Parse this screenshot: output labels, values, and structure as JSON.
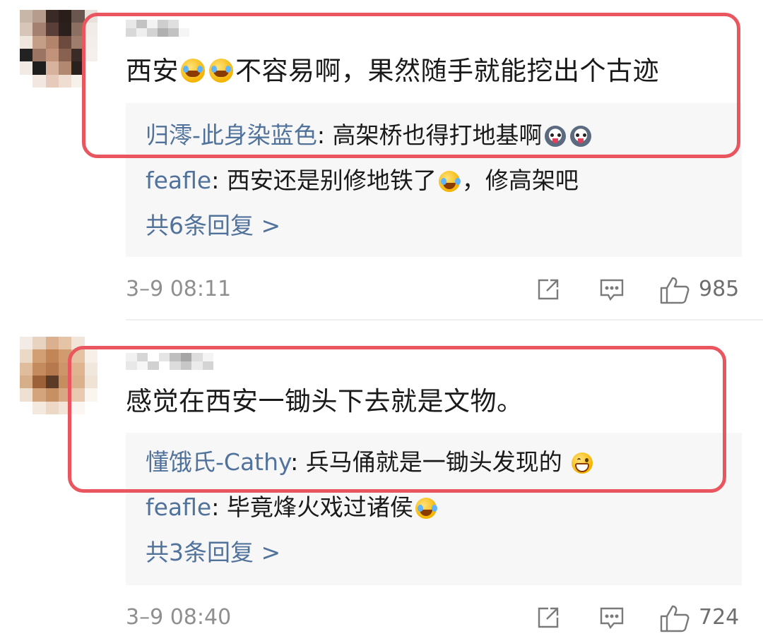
{
  "comments": [
    {
      "content_text_1": "西安",
      "content_text_2": "不容易啊，果然随手就能挖出个古迹",
      "content_emojis": [
        "laugh-cry-emoji",
        "laugh-cry-emoji"
      ],
      "replies": [
        {
          "name": "归澪-此身染蓝色",
          "sep": ": ",
          "text": "高架桥也得打地基啊",
          "emojis": [
            "husky-emoji",
            "husky-emoji"
          ]
        },
        {
          "name": "feafle",
          "sep": ": ",
          "text_1": "西安还是别修地铁了",
          "text_2": "，修高架吧",
          "emojis": [
            "laugh-cry-emoji"
          ]
        }
      ],
      "more_replies": "共6条回复 >",
      "time": "3–9 08:11",
      "likes": "985"
    },
    {
      "content_text_1": "感觉在西安一锄头下去就是文物。",
      "replies": [
        {
          "name": "懂饿氏-Cathy",
          "sep": ": ",
          "text": "兵马俑就是一锄头发现的 ",
          "emojis": [
            "grin-emoji"
          ]
        },
        {
          "name": "feafle",
          "sep": ": ",
          "text": "毕竟烽火戏过诸侯",
          "emojis": [
            "laugh-emoji"
          ]
        }
      ],
      "more_replies": "共3条回复 >",
      "time": "3–9 08:40",
      "likes": "724"
    }
  ],
  "icons": {
    "share": "share-icon",
    "comment": "comment-icon",
    "like": "thumbs-up-icon"
  },
  "colors": {
    "link_blue": "#51729b",
    "highlight_red": "#e9565f",
    "reply_bg": "#f7f7f7",
    "meta_gray": "#8f8f8f"
  }
}
